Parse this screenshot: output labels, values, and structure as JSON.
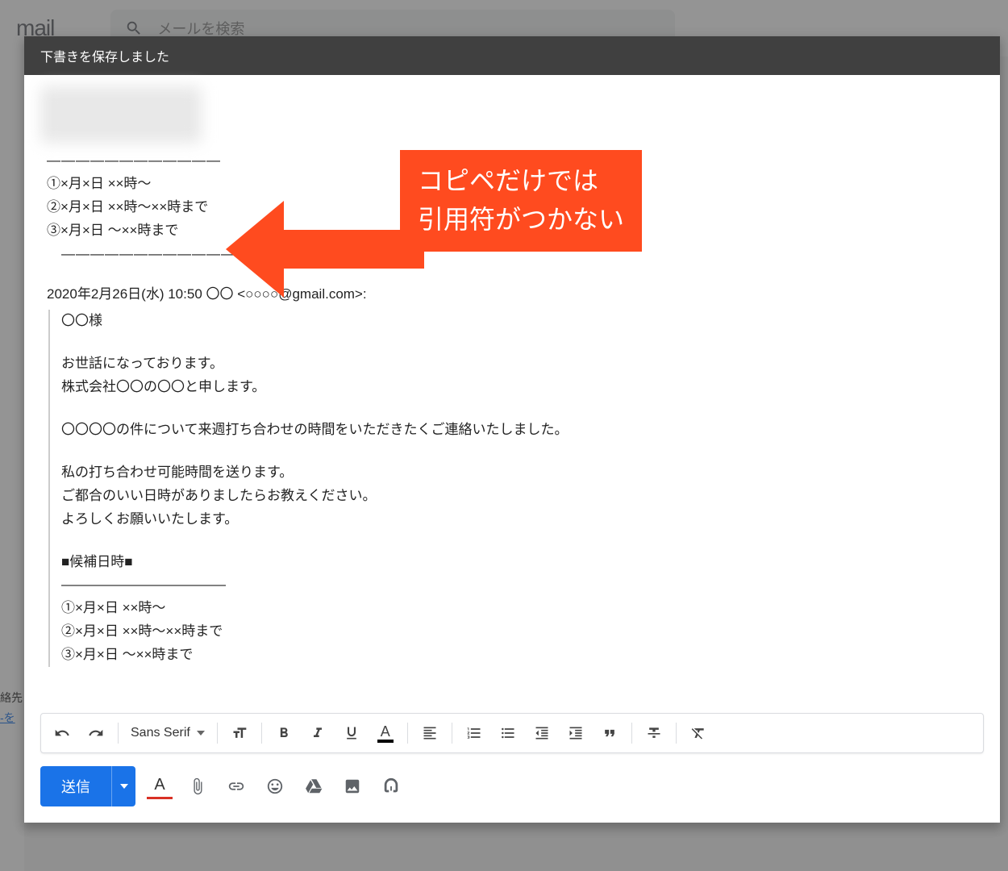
{
  "background": {
    "logo": "mail",
    "search_placeholder": "メールを検索",
    "sidebar_label": "絡先",
    "sidebar_link": "-を"
  },
  "dialog": {
    "title": "下書きを保存しました",
    "callout_line1": "コピペだけでは",
    "callout_line2": "引用符がつかない",
    "body": {
      "dash1": "――――――――――――",
      "line1": "①×月×日 ××時～",
      "line2": "②×月×日 ××時～××時まで",
      "line3": "③×月×日 ～××時まで",
      "dash2": "　――――――――――――",
      "reply_header": "2020年2月26日(水) 10:50 〇〇 <○○○○@gmail.com>:",
      "quoted": {
        "q1": "〇〇様",
        "q2": "お世話になっております。",
        "q3": "株式会社〇〇の〇〇と申します。",
        "q4": "〇〇〇〇の件について来週打ち合わせの時間をいただきたくご連絡いたしました。",
        "q5": "私の打ち合わせ可能時間を送ります。",
        "q6": "ご都合のいい日時がありましたらお教えください。",
        "q7": "よろしくお願いいたします。",
        "q8": "■候補日時■",
        "q9": "――――――――――――",
        "q10": "①×月×日 ××時～",
        "q11": "②×月×日 ××時～××時まで",
        "q12": "③×月×日 ～××時まで"
      }
    },
    "toolbar": {
      "font_name": "Sans Serif",
      "send_label": "送信"
    }
  }
}
